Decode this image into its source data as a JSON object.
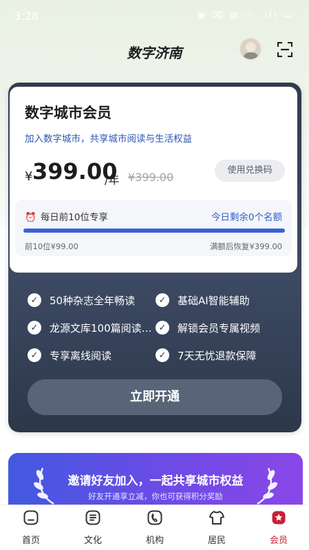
{
  "status_bar": {
    "time": "3:28",
    "icons": "▣ ⌧ ◍ ⌔ .ıll ▭"
  },
  "header": {
    "title": "数字济南",
    "avatar": "avatar",
    "scan_icon": "scan-icon"
  },
  "membership": {
    "title": "数字城市会员",
    "subtitle": "加入数字城市，共享城市阅读与生活权益",
    "currency": "¥",
    "price": "399.00",
    "per": "/年",
    "original_price": "¥399.00",
    "redeem_label": "使用兑换码",
    "quota": {
      "label": "每日前10位专享",
      "remaining": "今日剩余0个名额",
      "progress_percent": 100,
      "foot_left": "前10位¥99.00",
      "foot_right": "满额后恢复¥399.00"
    }
  },
  "features": [
    "50种杂志全年畅读",
    "基础AI智能辅助",
    "龙源文库100篇阅读…",
    "解锁会员专属视频",
    "专享离线阅读",
    "7天无忧退款保障"
  ],
  "open_button": "立即开通",
  "invite": {
    "title": "邀请好友加入，一起共享城市权益",
    "subtitle": "好友开通享立减，你也可获得积分奖励"
  },
  "nav": [
    {
      "label": "首页",
      "icon": "home-icon"
    },
    {
      "label": "文化",
      "icon": "culture-icon"
    },
    {
      "label": "机构",
      "icon": "institution-icon"
    },
    {
      "label": "居民",
      "icon": "resident-icon"
    },
    {
      "label": "会员",
      "icon": "member-icon"
    }
  ],
  "colors": {
    "accent": "#2f5fd0",
    "nav_active": "#c8203a",
    "card_dark": "#323b4e"
  }
}
